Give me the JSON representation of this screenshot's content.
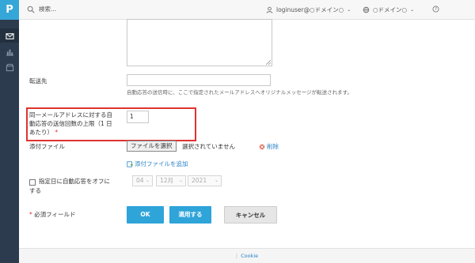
{
  "app": {
    "logo": "P"
  },
  "topbar": {
    "search_placeholder": "検索...",
    "user": "loginuser@○ドメイン○",
    "domain": "○ドメイン○"
  },
  "form": {
    "forward_label": "転送先",
    "forward_help": "自動応答の送信時に、ここで指定されたメールアドレスへオリジナルメッセージが転送されます。",
    "limit_label_line1": "同一メールアドレスに対する自",
    "limit_label_line2": "動応答の送信回数の上限（1 日",
    "limit_label_line3": "あたり）",
    "limit_value": "1",
    "attachment_label": "添付ファイル",
    "file_button": "ファイルを選択",
    "file_status": "選択されていません",
    "delete_link": "削除",
    "add_attachment_link": "添付ファイルを追加",
    "auto_off_label_line1": "指定日に自動応答をオフに",
    "auto_off_label_line2": "する",
    "date": {
      "day": "04",
      "month": "12月",
      "year": "2021"
    },
    "required_label": "必須フィールド",
    "required_mark": "*"
  },
  "buttons": {
    "ok": "OK",
    "apply": "適用する",
    "cancel": "キャンセル"
  },
  "footer": {
    "cookie": "Cookie"
  },
  "colors": {
    "accent": "#2ea4d9",
    "sidebar": "#2d3b4f",
    "highlight": "#e0332f",
    "link": "#2a83c6"
  }
}
